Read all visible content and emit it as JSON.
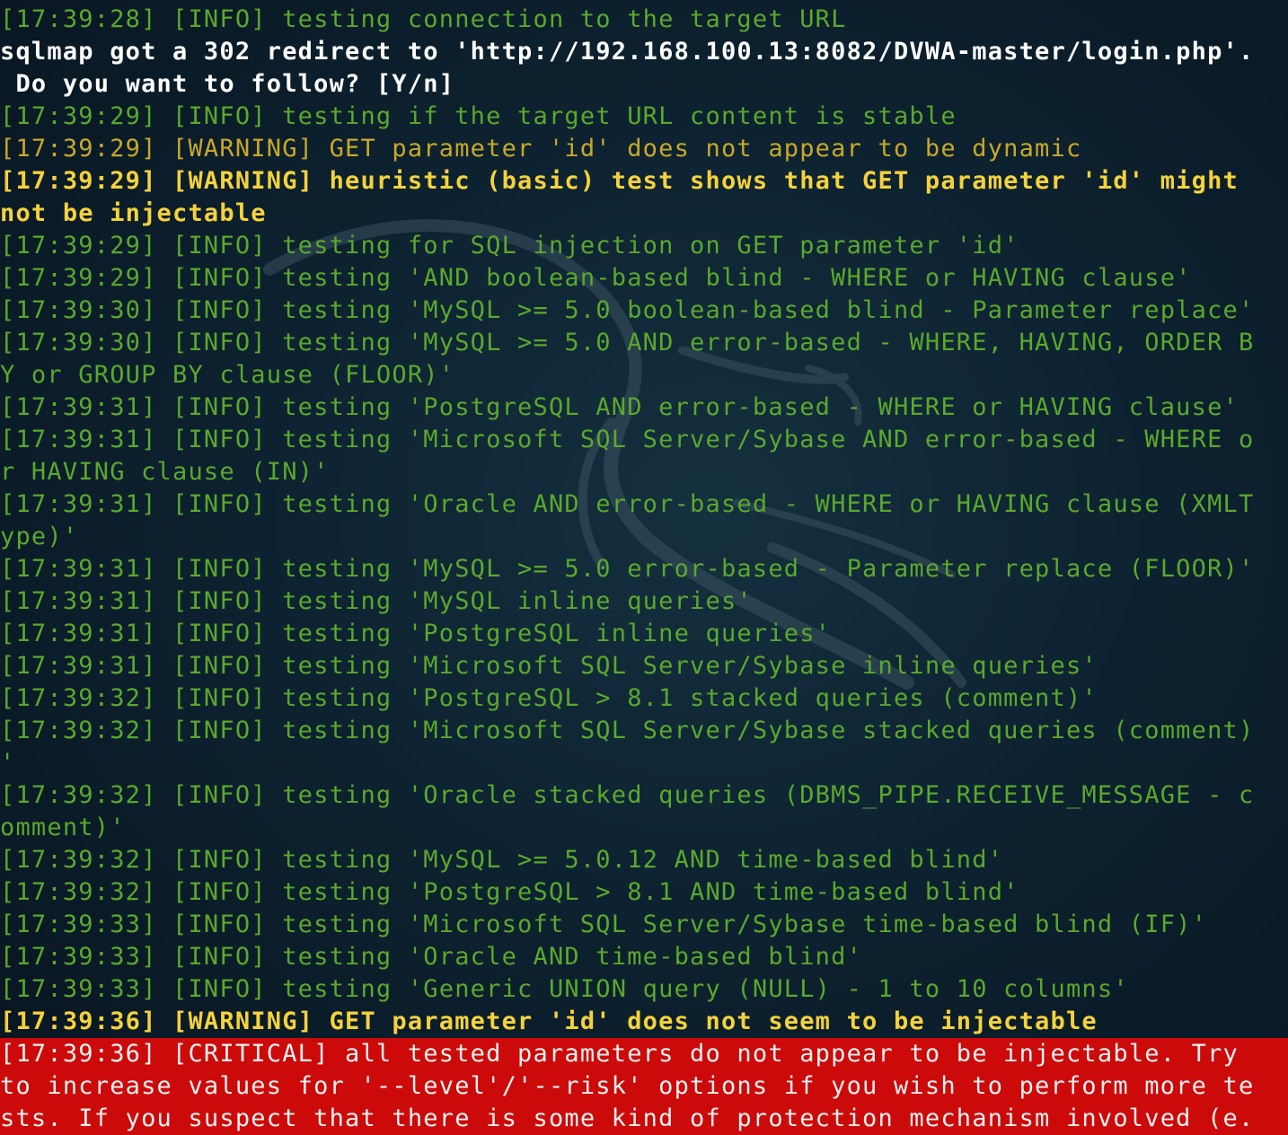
{
  "colors": {
    "info": "#5aa82c",
    "warning": "#c8a82a",
    "warning_bold": "#f4d23c",
    "plain": "#ffffff",
    "critical_bg": "#cc0a0a",
    "background": "#0d2230"
  },
  "background_logo": "kali-dragon-watermark",
  "lines": [
    {
      "style": "info",
      "text": "[17:39:28] [INFO] testing connection to the target URL"
    },
    {
      "style": "plain-bold",
      "text": "sqlmap got a 302 redirect to 'http://192.168.100.13:8082/DVWA-master/login.php'."
    },
    {
      "style": "plain-bold",
      "text": " Do you want to follow? [Y/n]"
    },
    {
      "style": "info",
      "text": "[17:39:29] [INFO] testing if the target URL content is stable"
    },
    {
      "style": "warning",
      "text": "[17:39:29] [WARNING] GET parameter 'id' does not appear to be dynamic"
    },
    {
      "style": "warning-bold",
      "text": "[17:39:29] [WARNING] heuristic (basic) test shows that GET parameter 'id' might"
    },
    {
      "style": "warning-bold",
      "text": "not be injectable"
    },
    {
      "style": "info",
      "text": "[17:39:29] [INFO] testing for SQL injection on GET parameter 'id'"
    },
    {
      "style": "info",
      "text": "[17:39:29] [INFO] testing 'AND boolean-based blind - WHERE or HAVING clause'"
    },
    {
      "style": "info",
      "text": "[17:39:30] [INFO] testing 'MySQL >= 5.0 boolean-based blind - Parameter replace'"
    },
    {
      "style": "info",
      "text": "[17:39:30] [INFO] testing 'MySQL >= 5.0 AND error-based - WHERE, HAVING, ORDER B"
    },
    {
      "style": "info",
      "text": "Y or GROUP BY clause (FLOOR)'"
    },
    {
      "style": "info",
      "text": "[17:39:31] [INFO] testing 'PostgreSQL AND error-based - WHERE or HAVING clause'"
    },
    {
      "style": "info",
      "text": "[17:39:31] [INFO] testing 'Microsoft SQL Server/Sybase AND error-based - WHERE o"
    },
    {
      "style": "info",
      "text": "r HAVING clause (IN)'"
    },
    {
      "style": "info",
      "text": "[17:39:31] [INFO] testing 'Oracle AND error-based - WHERE or HAVING clause (XMLT"
    },
    {
      "style": "info",
      "text": "ype)'"
    },
    {
      "style": "info",
      "text": "[17:39:31] [INFO] testing 'MySQL >= 5.0 error-based - Parameter replace (FLOOR)'"
    },
    {
      "style": "info",
      "text": "[17:39:31] [INFO] testing 'MySQL inline queries'"
    },
    {
      "style": "info",
      "text": "[17:39:31] [INFO] testing 'PostgreSQL inline queries'"
    },
    {
      "style": "info",
      "text": "[17:39:31] [INFO] testing 'Microsoft SQL Server/Sybase inline queries'"
    },
    {
      "style": "info",
      "text": "[17:39:32] [INFO] testing 'PostgreSQL > 8.1 stacked queries (comment)'"
    },
    {
      "style": "info",
      "text": "[17:39:32] [INFO] testing 'Microsoft SQL Server/Sybase stacked queries (comment)"
    },
    {
      "style": "info",
      "text": "'"
    },
    {
      "style": "info",
      "text": "[17:39:32] [INFO] testing 'Oracle stacked queries (DBMS_PIPE.RECEIVE_MESSAGE - c"
    },
    {
      "style": "info",
      "text": "omment)'"
    },
    {
      "style": "info",
      "text": "[17:39:32] [INFO] testing 'MySQL >= 5.0.12 AND time-based blind'"
    },
    {
      "style": "info",
      "text": "[17:39:32] [INFO] testing 'PostgreSQL > 8.1 AND time-based blind'"
    },
    {
      "style": "info",
      "text": "[17:39:33] [INFO] testing 'Microsoft SQL Server/Sybase time-based blind (IF)'"
    },
    {
      "style": "info",
      "text": "[17:39:33] [INFO] testing 'Oracle AND time-based blind'"
    },
    {
      "style": "info",
      "text": "[17:39:33] [INFO] testing 'Generic UNION query (NULL) - 1 to 10 columns'"
    },
    {
      "style": "warning-bold",
      "text": "[17:39:36] [WARNING] GET parameter 'id' does not seem to be injectable"
    },
    {
      "style": "critical",
      "text": "[17:39:36] [CRITICAL] all tested parameters do not appear to be injectable. Try "
    },
    {
      "style": "critical",
      "text": "to increase values for '--level'/'--risk' options if you wish to perform more te"
    },
    {
      "style": "critical",
      "text": "sts. If you suspect that there is some kind of protection mechanism involved (e."
    }
  ]
}
